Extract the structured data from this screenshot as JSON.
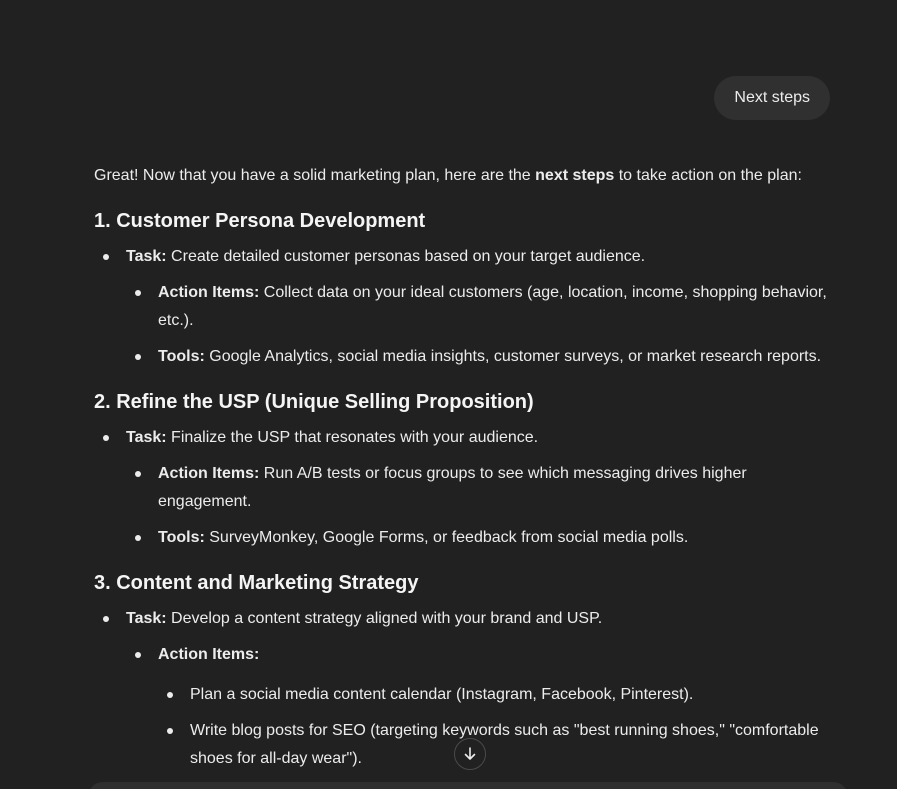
{
  "user_message": "Next steps",
  "reply": {
    "intro_before": "Great! Now that you have a solid marketing plan, here are the ",
    "intro_bold": "next steps",
    "intro_after": " to take action on the plan:",
    "sections": [
      {
        "heading": "1. Customer Persona Development",
        "task_label": "Task:",
        "task_text": " Create detailed customer personas based on your target audience.",
        "items": [
          {
            "label": "Action Items:",
            "text": " Collect data on your ideal customers (age, location, income, shopping behavior, etc.)."
          },
          {
            "label": "Tools:",
            "text": " Google Analytics, social media insights, customer surveys, or market research reports."
          }
        ]
      },
      {
        "heading": "2. Refine the USP (Unique Selling Proposition)",
        "task_label": "Task:",
        "task_text": " Finalize the USP that resonates with your audience.",
        "items": [
          {
            "label": "Action Items:",
            "text": " Run A/B tests or focus groups to see which messaging drives higher engagement."
          },
          {
            "label": "Tools:",
            "text": " SurveyMonkey, Google Forms, or feedback from social media polls."
          }
        ]
      },
      {
        "heading": "3. Content and Marketing Strategy",
        "task_label": "Task:",
        "task_text": " Develop a content strategy aligned with your brand and USP.",
        "action_label": "Action Items:",
        "sub_items": [
          "Plan a social media content calendar (Instagram, Facebook, Pinterest).",
          "Write blog posts for SEO (targeting keywords such as \"best running shoes,\" \"comfortable shoes for all-day wear\")."
        ]
      }
    ]
  },
  "icons": {
    "scroll_down": "arrow-down-icon"
  }
}
